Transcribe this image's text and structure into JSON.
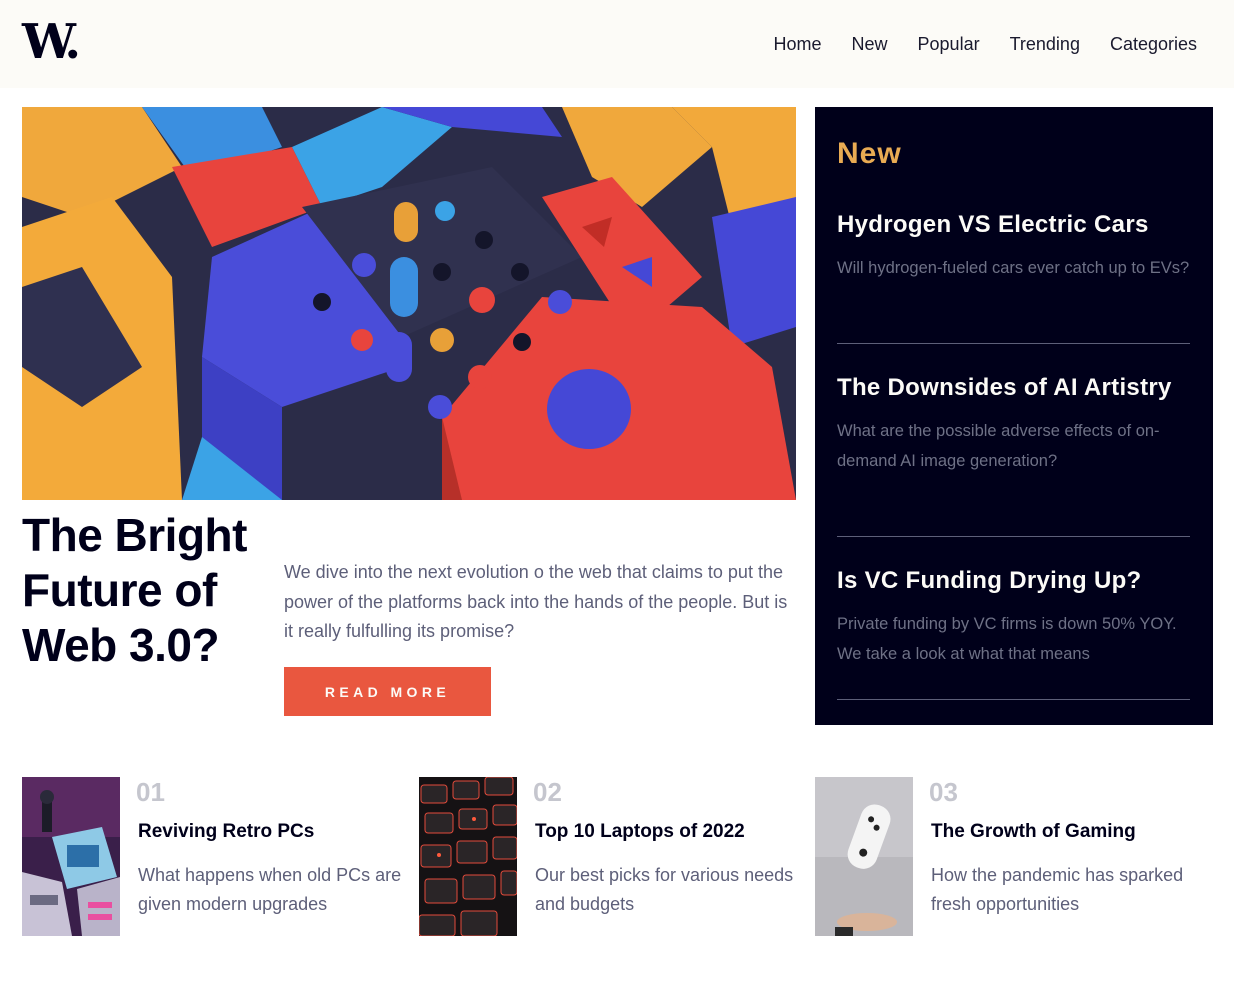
{
  "header": {
    "logo": "W.",
    "nav": [
      "Home",
      "New",
      "Popular",
      "Trending",
      "Categories"
    ]
  },
  "hero": {
    "title": "The Bright Future of Web 3.0?",
    "description": "We dive into the next evolution o the web that claims to put the power of the platforms back into the hands of the people. But is it really fulfulling its promise?",
    "button_label": "READ MORE"
  },
  "new_panel": {
    "heading": "New",
    "items": [
      {
        "title": "Hydrogen VS Electric Cars",
        "description": "Will hydrogen-fueled cars ever catch up to EVs?"
      },
      {
        "title": "The Downsides of AI Artistry",
        "description": "What are the possible adverse effects of on-demand AI image generation?"
      },
      {
        "title": "Is VC Funding Drying Up?",
        "description": "Private funding by VC firms is down 50% YOY. We take a look at what that means"
      }
    ]
  },
  "cards": [
    {
      "number": "01",
      "title": "Reviving Retro PCs",
      "description": "What happens when old PCs are given modern upgrades"
    },
    {
      "number": "02",
      "title": "Top 10 Laptops of 2022",
      "description": "Our best picks for various needs and budgets"
    },
    {
      "number": "03",
      "title": "The Growth of Gaming",
      "description": "How the pandemic has sparked fresh opportunities"
    }
  ],
  "colors": {
    "accent": "#e9573f",
    "new_heading": "#e9ab53",
    "dark_panel": "#00001a",
    "muted_text": "#5d5f79"
  }
}
